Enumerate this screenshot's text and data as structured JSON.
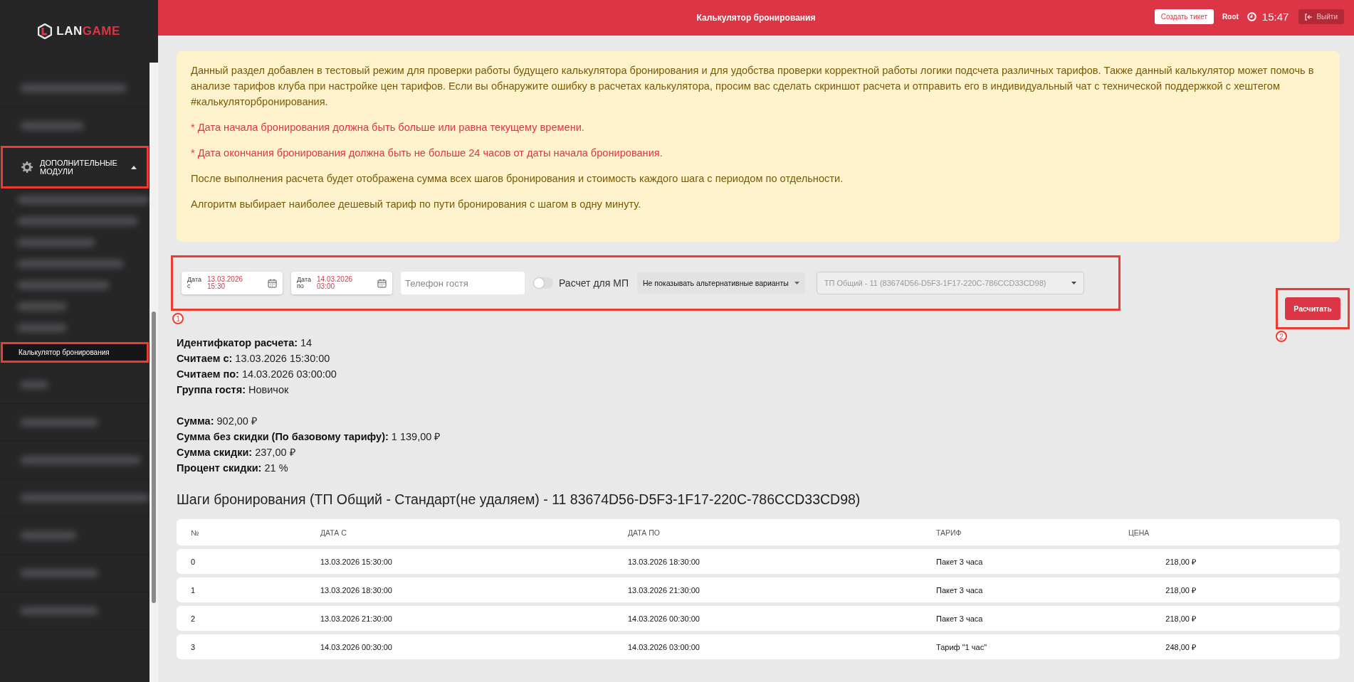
{
  "brand": {
    "part1": "LAN",
    "part2": "GAME"
  },
  "sidebar": {
    "items": [
      {
        "label": "ДОПОЛНИТЕЛЬНЫЕ МОДУЛИ",
        "expanded": true,
        "highlighted": true,
        "children": [
          {
            "label": "Калькулятор бронирования",
            "selected": true,
            "highlighted": true
          }
        ]
      }
    ]
  },
  "header": {
    "title": "Калькулятор бронирования",
    "ticket_button": "Создать тикет",
    "user": "Root",
    "time": "15:47",
    "logout_button": "Выйти"
  },
  "notice": {
    "paragraphs": [
      {
        "kind": "info",
        "text": "Данный раздел добавлен в тестовый режим для проверки работы будущего калькулятора бронирования и для удобства проверки корректной работы логики подсчета различных тарифов. Также данный калькулятор может помочь в анализе тарифов клуба при настройке цен тарифов. Если вы обнаружите ошибку в расчетах калькулятора, просим вас сделать скриншот расчета и отправить его в индивидуальный чат с технической поддержкой с хештегом #калькуляторбронирования."
      },
      {
        "kind": "warning",
        "text": "* Дата начала бронирования должна быть больше или равна текущему времени."
      },
      {
        "kind": "warning",
        "text": "* Дата окончания бронирования должна быть не больше 24 часов от даты начала бронирования."
      },
      {
        "kind": "info",
        "text": "После выполнения расчета будет отображена сумма всех шагов бронирования и стоимость каждого шага с периодом по отдельности."
      },
      {
        "kind": "info",
        "text": "Алгоритм выбирает наиболее дешевый тариф по пути бронирования с шагом в одну минуту."
      }
    ]
  },
  "form": {
    "annotation": "1",
    "date_from": {
      "label": "Дата с",
      "date": "13.03.2026",
      "time": "15:30"
    },
    "date_to": {
      "label": "Дата по",
      "date": "14.03.2026",
      "time": "03:00"
    },
    "phone": {
      "placeholder": "Телефон гостя"
    },
    "mp_toggle": {
      "label": "Расчет для МП",
      "on": false
    },
    "alternatives": "Не показывать альтернативные варианты",
    "tariff_group": "ТП Общий - 11 (83674D56-D5F3-1F17-220C-786CCD33CD98)"
  },
  "calculate": {
    "label": "Расчитать",
    "annotation": "2"
  },
  "details": [
    "**Идентифкатор расчета:** 14",
    "**Считаем с:** 13.03.2026 15:30:00",
    "**Считаем по:** 14.03.2026 03:00:00",
    "**Группа гостя:** Новичок"
  ],
  "totals": [
    "**Сумма:** 902,00 ₽",
    "**Сумма без скидки (По базовому тарифу):** 1 139,00 ₽",
    "**Сумма скидки:** 237,00 ₽",
    "**Процент скидки:** 21 %"
  ],
  "steps_title": "Шаги бронирования (ТП Общий - Стандарт(не удаляем) - 11 83674D56-D5F3-1F17-220C-786CCD33CD98)",
  "table": {
    "columns": [
      "№",
      "ДАТА С",
      "ДАТА ПО",
      "ТАРИФ",
      "ЦЕНА"
    ],
    "rows": [
      [
        "0",
        "13.03.2026 15:30:00",
        "13.03.2026 18:30:00",
        "Пакет 3 часа",
        "218,00 ₽"
      ],
      [
        "1",
        "13.03.2026 18:30:00",
        "13.03.2026 21:30:00",
        "Пакет 3 часа",
        "218,00 ₽"
      ],
      [
        "2",
        "13.03.2026 21:30:00",
        "14.03.2026 00:30:00",
        "Пакет 3 часа",
        "218,00 ₽"
      ],
      [
        "3",
        "14.03.2026 00:30:00",
        "14.03.2026 03:00:00",
        "Тариф \"1 час\"",
        "248,00 ₽"
      ]
    ]
  }
}
